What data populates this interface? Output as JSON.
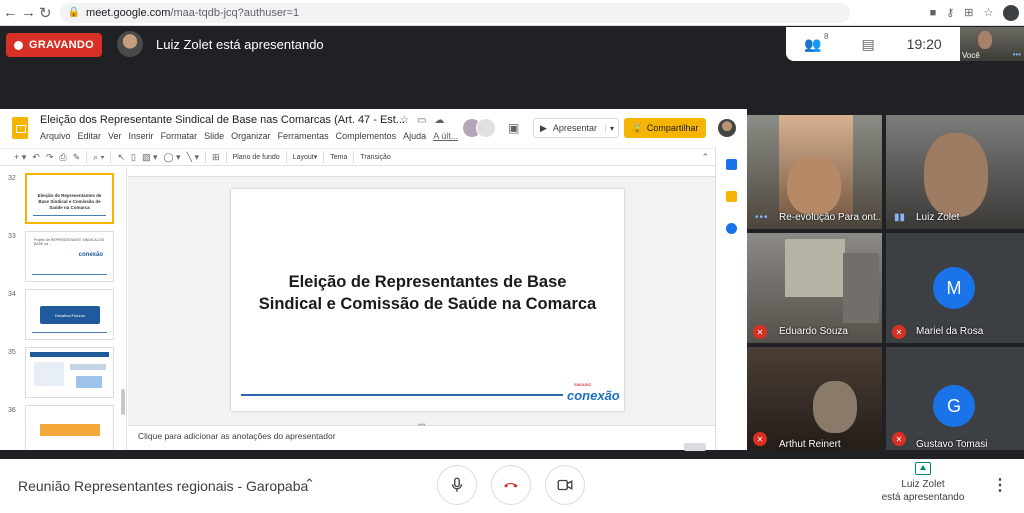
{
  "browser": {
    "url_host": "meet.google.com",
    "url_path": "/maa-tqdb-jcq?authuser=1"
  },
  "meet_header": {
    "recording_label": "GRAVANDO",
    "presenting_text": "Luiz Zolet está apresentando",
    "participant_count": "8",
    "clock": "19:20",
    "self_label": "Você"
  },
  "slides_app": {
    "doc_title": "Eleição dos Representante Sindical de Base nas Comarcas  (Art. 47 - Est...",
    "menu": [
      "Arquivo",
      "Editar",
      "Ver",
      "Inserir",
      "Formatar",
      "Slide",
      "Organizar",
      "Ferramentas",
      "Complementos",
      "Ajuda",
      "A últ..."
    ],
    "present_button": "Apresentar",
    "share_button": "Compartilhar",
    "toolbar": {
      "background": "Plano de fundo",
      "layout": "Layout",
      "theme": "Tema",
      "transition": "Transição"
    },
    "thumbnails": [
      {
        "number": "32",
        "title": "Eleição de Representantes de Base Sindical e Comissão de Saúde na Comarca",
        "selected": true
      },
      {
        "number": "33",
        "mini_text": "Projeto de REPRESENTANTE SINDICAL DE BASE na ...",
        "logo": "conexão"
      },
      {
        "number": "34",
        "box_text": "Desafios Futuros"
      },
      {
        "number": "35"
      },
      {
        "number": "36"
      }
    ],
    "slide": {
      "title_line1": "Eleição de Representantes de Base",
      "title_line2": "Sindical e Comissão de Saúde na Comarca",
      "logo_small": "SINJUSC",
      "logo": "conexão"
    },
    "notes_placeholder": "Clique para adicionar as anotações do apresentador"
  },
  "participants": [
    {
      "name": "Re-evolução Para ont...",
      "muted": false,
      "indicator": "dots"
    },
    {
      "name": "Luiz Zolet",
      "muted": false,
      "indicator": "bars"
    },
    {
      "name": "Eduardo Souza",
      "muted": true
    },
    {
      "name": "Mariel da Rosa",
      "muted": true,
      "avatar_letter": "M",
      "avatar_color": "#1a73e8"
    },
    {
      "name": "Arthut Reinert",
      "muted": true
    },
    {
      "name": "Gustavo Tomasi",
      "muted": true,
      "avatar_letter": "G",
      "avatar_color": "#1a73e8"
    }
  ],
  "bottom_bar": {
    "meeting_name": "Reunião Representantes regionais - Garopaba",
    "presenting_line1": "Luiz Zolet",
    "presenting_line2": "está apresentando"
  },
  "colors": {
    "record_red": "#d93025",
    "slides_yellow": "#f4b400",
    "hangup_red": "#d93025",
    "accent_blue": "#1a73e8"
  }
}
